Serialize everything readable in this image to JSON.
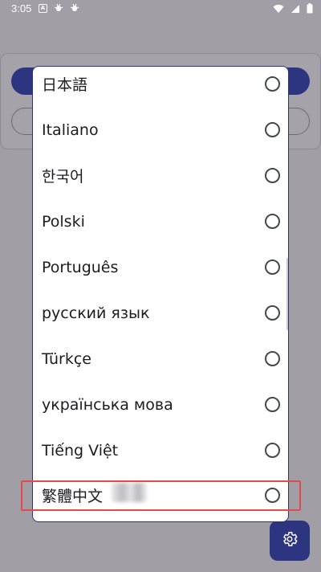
{
  "status_bar": {
    "time": "3:05",
    "left_icons": [
      "notification-a-icon",
      "bug-icon",
      "bug-icon"
    ],
    "right_icons": [
      "wifi-icon",
      "signal-icon",
      "battery-icon"
    ]
  },
  "dialog": {
    "options": [
      {
        "label": "日本語",
        "selected": false
      },
      {
        "label": "Italiano",
        "selected": false
      },
      {
        "label": "한국어",
        "selected": false
      },
      {
        "label": "Polski",
        "selected": false
      },
      {
        "label": "Português",
        "selected": false
      },
      {
        "label": "русский язык",
        "selected": false
      },
      {
        "label": "Türkçe",
        "selected": false
      },
      {
        "label": "українська мова",
        "selected": false
      },
      {
        "label": "Tiếng Việt",
        "selected": false
      },
      {
        "label": "繁體中文",
        "selected": false
      }
    ]
  },
  "fab": {
    "icon": "gear-icon"
  },
  "colors": {
    "accent": "#2d3480",
    "highlight": "#e34a4a",
    "scrim": "#a29ea6"
  }
}
